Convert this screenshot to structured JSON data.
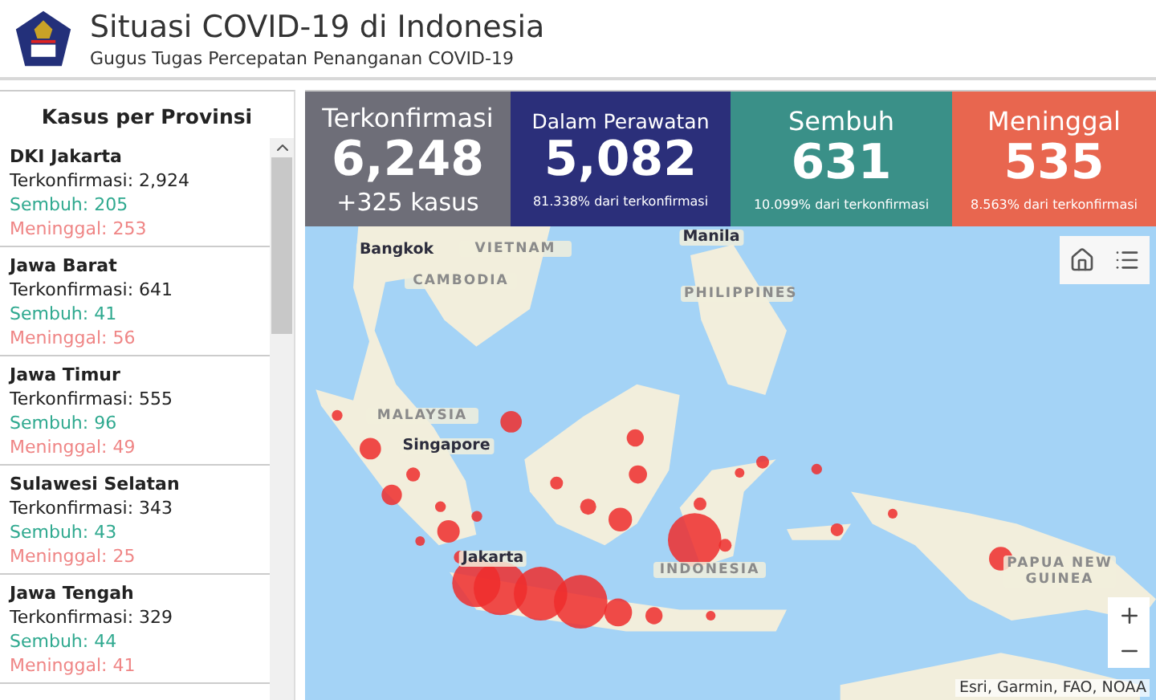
{
  "header": {
    "title": "Situasi COVID-19 di Indonesia",
    "subtitle": "Gugus Tugas Percepatan Penanganan COVID-19"
  },
  "sidebar": {
    "title": "Kasus per Provinsi",
    "provinces": [
      {
        "name": "DKI Jakarta",
        "confirmed": "Terkonfirmasi: 2,924",
        "recovered": "Sembuh: 205",
        "deaths": "Meninggal: 253"
      },
      {
        "name": "Jawa Barat",
        "confirmed": "Terkonfirmasi: 641",
        "recovered": "Sembuh: 41",
        "deaths": "Meninggal: 56"
      },
      {
        "name": "Jawa Timur",
        "confirmed": "Terkonfirmasi: 555",
        "recovered": "Sembuh: 96",
        "deaths": "Meninggal: 49"
      },
      {
        "name": "Sulawesi Selatan",
        "confirmed": "Terkonfirmasi: 343",
        "recovered": "Sembuh: 43",
        "deaths": "Meninggal: 25"
      },
      {
        "name": "Jawa Tengah",
        "confirmed": "Terkonfirmasi: 329",
        "recovered": "Sembuh: 44",
        "deaths": "Meninggal: 41"
      }
    ]
  },
  "stats": [
    {
      "label": "Terkonfirmasi",
      "value": "6,248",
      "note": "+325 kasus",
      "kind": "large-note",
      "color": "#6e6e78"
    },
    {
      "label": "Dalam Perawatan",
      "value": "5,082",
      "note": "81.338% dari terkonfirmasi",
      "kind": "small-note",
      "color": "#2b2f7a"
    },
    {
      "label": "Sembuh",
      "value": "631",
      "note": "10.099% dari terkonfirmasi",
      "kind": "small-note",
      "color": "#3a9088"
    },
    {
      "label": "Meninggal",
      "value": "535",
      "note": "8.563% dari terkonfirmasi",
      "kind": "small-note",
      "color": "#e8664f"
    }
  ],
  "map": {
    "labels": [
      {
        "text": "Bangkok",
        "kind": "city"
      },
      {
        "text": "VIETNAM",
        "kind": "country"
      },
      {
        "text": "CAMBODIA",
        "kind": "country"
      },
      {
        "text": "Manila",
        "kind": "city"
      },
      {
        "text": "PHILIPPINES",
        "kind": "country"
      },
      {
        "text": "MALAYSIA",
        "kind": "country"
      },
      {
        "text": "Singapore",
        "kind": "city"
      },
      {
        "text": "Jakarta",
        "kind": "city"
      },
      {
        "text": "INDONESIA",
        "kind": "country"
      },
      {
        "text": "PAPUA NEW GUINEA",
        "kind": "country"
      }
    ],
    "attribution": "Esri, Garmin, FAO, NOAA"
  }
}
